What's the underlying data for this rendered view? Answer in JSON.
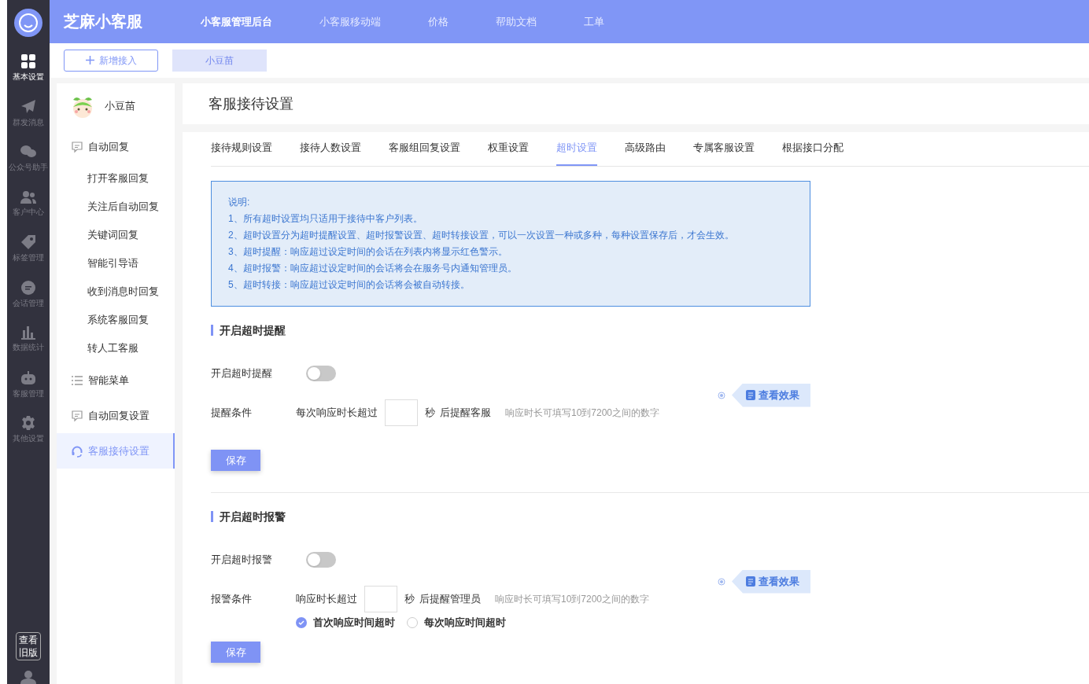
{
  "brand": "芝麻小客服",
  "nav_rail": {
    "items": [
      {
        "label": "基本设置",
        "selected": true
      },
      {
        "label": "群发消息",
        "selected": false
      },
      {
        "label": "公众号助手",
        "selected": false
      },
      {
        "label": "客户中心",
        "selected": false
      },
      {
        "label": "标签管理",
        "selected": false
      },
      {
        "label": "会话管理",
        "selected": false
      },
      {
        "label": "数据统计",
        "selected": false
      },
      {
        "label": "客服管理",
        "selected": false
      },
      {
        "label": "其他设置",
        "selected": false
      }
    ],
    "old_version": "查看旧版"
  },
  "top_nav": [
    {
      "label": "小客服管理后台",
      "selected": true
    },
    {
      "label": "小客服移动端",
      "selected": false
    },
    {
      "label": "价格",
      "selected": false
    },
    {
      "label": "帮助文档",
      "selected": false
    },
    {
      "label": "工单",
      "selected": false
    }
  ],
  "add_button": "新增接入",
  "account_tabs": [
    {
      "label": "小豆苗",
      "selected": true
    }
  ],
  "side_menu": {
    "account": "小豆苗",
    "items": [
      {
        "label": "自动回复",
        "kind": "chat",
        "selected": false
      },
      {
        "label": "打开客服回复",
        "kind": "sub",
        "selected": false
      },
      {
        "label": "关注后自动回复",
        "kind": "sub",
        "selected": false
      },
      {
        "label": "关键词回复",
        "kind": "sub",
        "selected": false
      },
      {
        "label": "智能引导语",
        "kind": "sub",
        "selected": false
      },
      {
        "label": "收到消息时回复",
        "kind": "sub",
        "selected": false
      },
      {
        "label": "系统客服回复",
        "kind": "sub",
        "selected": false
      },
      {
        "label": "转人工客服",
        "kind": "sub",
        "selected": false
      },
      {
        "label": "智能菜单",
        "kind": "list",
        "selected": false
      },
      {
        "label": "自动回复设置",
        "kind": "chat",
        "selected": false
      },
      {
        "label": "客服接待设置",
        "kind": "headset",
        "selected": true
      }
    ]
  },
  "page_title": "客服接待设置",
  "tabs": [
    {
      "label": "接待规则设置",
      "selected": false
    },
    {
      "label": "接待人数设置",
      "selected": false
    },
    {
      "label": "客服组回复设置",
      "selected": false
    },
    {
      "label": "权重设置",
      "selected": false
    },
    {
      "label": "超时设置",
      "selected": true
    },
    {
      "label": "高级路由",
      "selected": false
    },
    {
      "label": "专属客服设置",
      "selected": false
    },
    {
      "label": "根据接口分配",
      "selected": false
    }
  ],
  "notice": {
    "title": "说明:",
    "lines": [
      "1、所有超时设置均只适用于接待中客户列表。",
      "2、超时设置分为超时提醒设置、超时报警设置、超时转接设置，可以一次设置一种或多种，每种设置保存后，才会生效。",
      "3、超时提醒：响应超过设定时间的会话在列表内将显示红色警示。",
      "4、超时报警：响应超过设定时间的会话将会在服务号内通知管理员。",
      "5、超时转接：响应超过设定时间的会话将会被自动转接。"
    ]
  },
  "sections": [
    {
      "title": "开启超时提醒",
      "toggle_label": "开启超时提醒",
      "on": false,
      "condition_label": "提醒条件",
      "prefix": "每次响应时长超过",
      "unit": "秒",
      "suffix": "后提醒客服",
      "hint": "响应时长可填写10到7200之间的数字",
      "effect_button": "查看效果",
      "save": "保存"
    },
    {
      "title": "开启超时报警",
      "toggle_label": "开启超时报警",
      "on": false,
      "condition_label": "报警条件",
      "prefix": "响应时长超过",
      "unit": "秒",
      "suffix": "后提醒管理员",
      "hint": "响应时长可填写10到7200之间的数字",
      "effect_button": "查看效果",
      "radios": [
        {
          "label": "首次响应时间超时",
          "selected": true
        },
        {
          "label": "每次响应时间超时",
          "selected": false
        }
      ],
      "save": "保存"
    }
  ]
}
